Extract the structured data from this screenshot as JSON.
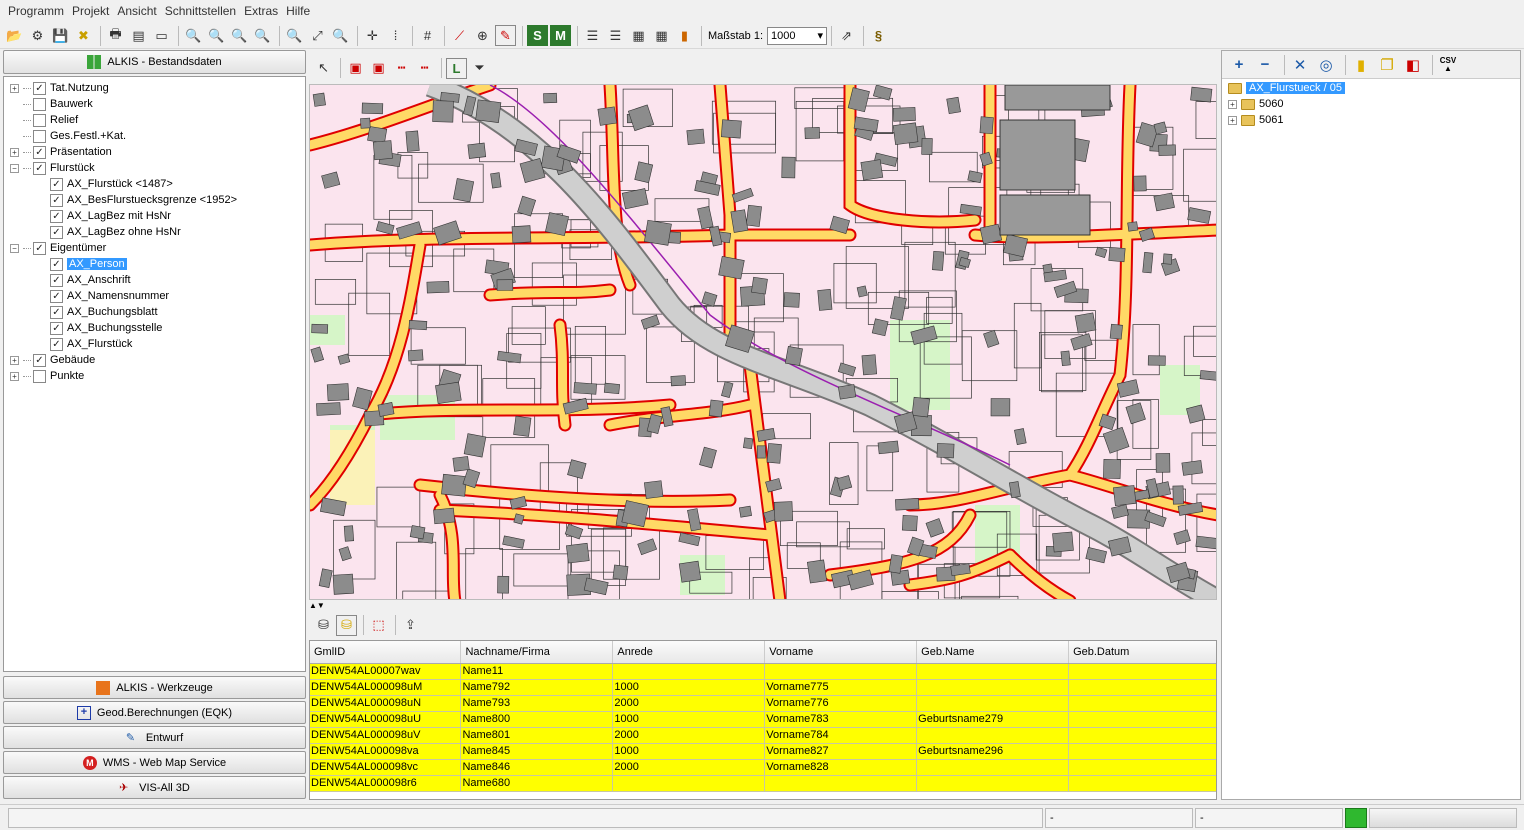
{
  "menu": [
    "Programm",
    "Projekt",
    "Ansicht",
    "Schnittstellen",
    "Extras",
    "Hilfe"
  ],
  "toolbar": {
    "scale_label": "Maßstab 1:",
    "scale_value": "1000",
    "section_icon": "§"
  },
  "left_panel": {
    "header": "ALKIS - Bestandsdaten",
    "tree": [
      {
        "label": "Tat.Nutzung",
        "checked": true,
        "level": 0,
        "expander": "+"
      },
      {
        "label": "Bauwerk",
        "checked": false,
        "level": 0,
        "expander": ""
      },
      {
        "label": "Relief",
        "checked": false,
        "level": 0,
        "expander": ""
      },
      {
        "label": "Ges.Festl.+Kat.",
        "checked": false,
        "level": 0,
        "expander": ""
      },
      {
        "label": "Präsentation",
        "checked": true,
        "level": 0,
        "expander": "+"
      },
      {
        "label": "Flurstück",
        "checked": true,
        "level": 0,
        "expander": "-"
      },
      {
        "label": "AX_Flurstück <1487>",
        "checked": true,
        "level": 1,
        "expander": ""
      },
      {
        "label": "AX_BesFlurstuecksgrenze <1952>",
        "checked": true,
        "level": 1,
        "expander": ""
      },
      {
        "label": "AX_LagBez mit HsNr",
        "checked": true,
        "level": 1,
        "expander": ""
      },
      {
        "label": "AX_LagBez ohne HsNr",
        "checked": true,
        "level": 1,
        "expander": ""
      },
      {
        "label": "Eigentümer",
        "checked": true,
        "level": 0,
        "expander": "-"
      },
      {
        "label": "AX_Person",
        "checked": true,
        "level": 1,
        "expander": "",
        "selected": true
      },
      {
        "label": "AX_Anschrift",
        "checked": true,
        "level": 1,
        "expander": ""
      },
      {
        "label": "AX_Namensnummer",
        "checked": true,
        "level": 1,
        "expander": ""
      },
      {
        "label": "AX_Buchungsblatt",
        "checked": true,
        "level": 1,
        "expander": ""
      },
      {
        "label": "AX_Buchungsstelle",
        "checked": true,
        "level": 1,
        "expander": ""
      },
      {
        "label": "AX_Flurstück",
        "checked": true,
        "level": 1,
        "expander": ""
      },
      {
        "label": "Gebäude",
        "checked": true,
        "level": 0,
        "expander": "+"
      },
      {
        "label": "Punkte",
        "checked": false,
        "level": 0,
        "expander": "+"
      }
    ],
    "bottom_buttons": [
      {
        "label": "ALKIS - Werkzeuge",
        "icon": "grid-icon"
      },
      {
        "label": "Geod.Berechnungen (EQK)",
        "icon": "plus-box-icon"
      },
      {
        "label": "Entwurf",
        "icon": "pencil-icon"
      },
      {
        "label": "WMS - Web Map Service",
        "icon": "wms-icon"
      },
      {
        "label": "VIS-All 3D",
        "icon": "plane-icon"
      }
    ]
  },
  "grid": {
    "columns": [
      "GmlID",
      "Nachname/Firma",
      "Anrede",
      "Vorname",
      "Geb.Name",
      "Geb.Datum"
    ],
    "rows": [
      [
        "DENW54AL00007wav",
        "Name11",
        "",
        "",
        "",
        ""
      ],
      [
        "DENW54AL000098uM",
        "Name792",
        "1000",
        "Vorname775",
        "",
        ""
      ],
      [
        "DENW54AL000098uN",
        "Name793",
        "2000",
        "Vorname776",
        "",
        ""
      ],
      [
        "DENW54AL000098uU",
        "Name800",
        "1000",
        "Vorname783",
        "Geburtsname279",
        ""
      ],
      [
        "DENW54AL000098uV",
        "Name801",
        "2000",
        "Vorname784",
        "",
        ""
      ],
      [
        "DENW54AL000098va",
        "Name845",
        "1000",
        "Vorname827",
        "Geburtsname296",
        ""
      ],
      [
        "DENW54AL000098vc",
        "Name846",
        "2000",
        "Vorname828",
        "",
        ""
      ],
      [
        "DENW54AL000098r6",
        "Name680",
        "",
        "",
        "",
        ""
      ]
    ]
  },
  "right_panel": {
    "csv_label": "CSV",
    "tree": [
      {
        "label": "AX_Flurstueck / 05",
        "level": 0,
        "selected": true
      },
      {
        "label": "5060",
        "level": 1
      },
      {
        "label": "5061",
        "level": 1
      }
    ]
  },
  "statusbar": {
    "cell1": "-",
    "cell2": "-"
  },
  "colors": {
    "map_background": "#fbe4ee",
    "road_fill": "#ffd966",
    "road_border": "#e00000",
    "building": "#8c8c8c",
    "green_area": "#d6f5c8",
    "grid_row": "#ffff00",
    "selection": "#3399ff"
  }
}
